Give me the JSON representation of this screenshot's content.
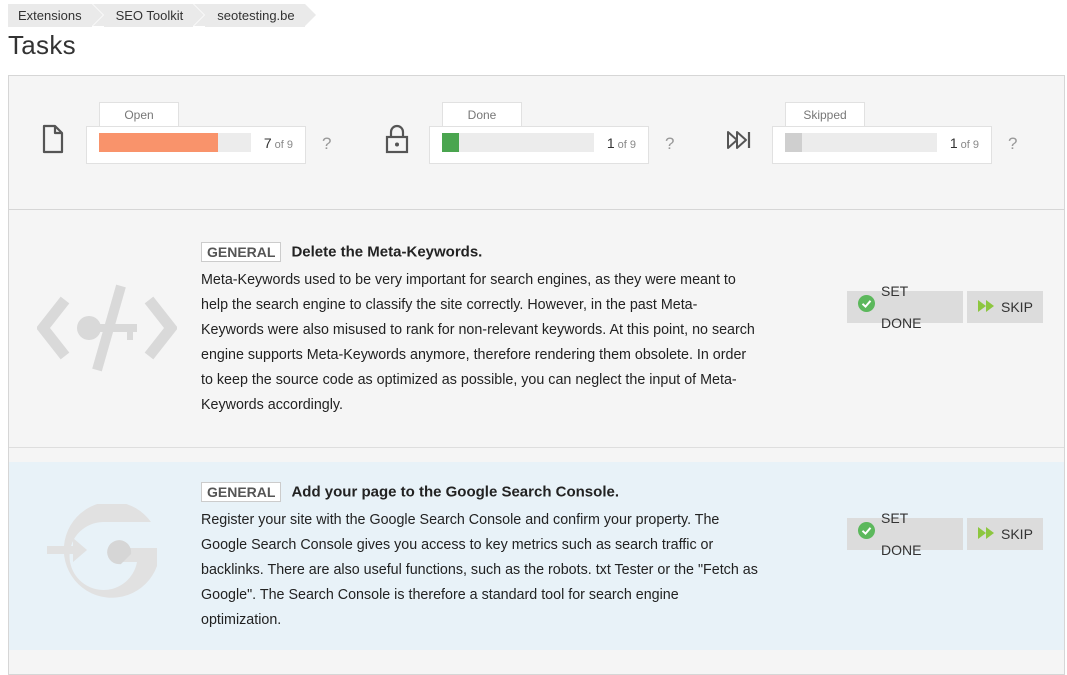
{
  "breadcrumb": [
    "Extensions",
    "SEO Toolkit",
    "seotesting.be"
  ],
  "page_title": "Tasks",
  "stats": {
    "open": {
      "label": "Open",
      "count": "7",
      "of": "of 9",
      "progress": 0.78,
      "color": "#f9936b",
      "help": "?"
    },
    "done": {
      "label": "Done",
      "count": "1",
      "of": "of 9",
      "progress": 0.11,
      "color": "#4aa54f",
      "help": "?"
    },
    "skipped": {
      "label": "Skipped",
      "count": "1",
      "of": "of 9",
      "progress": 0.11,
      "color": "#cfcfcf",
      "help": "?"
    }
  },
  "tasks": [
    {
      "tag": "GENERAL",
      "title": "Delete the Meta-Keywords.",
      "description_lines": [
        "Meta-Keywords used to be very important for search engines, as they were meant to",
        "help the search engine to classify the site correctly. However, in the past Meta-",
        "Keywords were also misused to rank for non-relevant keywords. At this point, no search",
        "engine supports Meta-Keywords anymore, therefore rendering them obsolete. In order",
        "to keep the source code as optimized as possible, you can neglect the input of Meta-",
        "Keywords accordingly."
      ],
      "set_done_label": "SET DONE",
      "skip_label": "SKIP",
      "icon": "code-key-icon"
    },
    {
      "tag": "GENERAL",
      "title": "Add your page to the Google Search Console.",
      "description_lines": [
        "Register your site with the Google Search Console and confirm your property. The",
        "Google Search Console gives you access to key metrics such as search traffic or",
        "backlinks. There are also useful functions, such as the robots. txt Tester or the \"Fetch as",
        "Google\". The Search Console is therefore a standard tool for search engine",
        "optimization."
      ],
      "set_done_label": "SET DONE",
      "skip_label": "SKIP",
      "icon": "google-wrench-icon"
    }
  ],
  "colors": {
    "accent_green": "#5cb85c",
    "skip_green": "#8cc63f",
    "highlight_row": "#e8f2f8"
  }
}
